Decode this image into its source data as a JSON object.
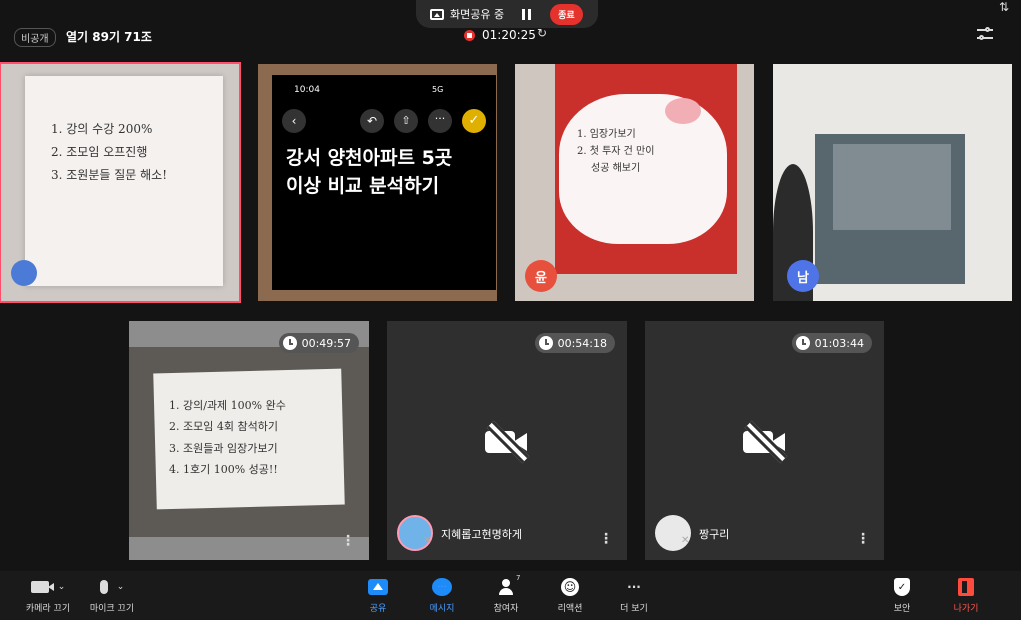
{
  "share_bar": {
    "label": "화면공유 중",
    "end_label": "종료"
  },
  "header": {
    "visibility": "비공개",
    "title": "열기 89기 71조",
    "elapsed": "01:20:25"
  },
  "tiles": {
    "t1": {
      "lines": [
        "1. 강의 수강 200%",
        "2. 조모임 오프진행",
        "3. 조원분들 질문 해소!"
      ]
    },
    "t2": {
      "status_time": "10:04",
      "status_net": "5G",
      "note_text": "강서 양천아파트 5곳 이상 비교 분석하기"
    },
    "t3": {
      "lines": [
        "1. 임장가보기",
        "2. 첫 투자 건 만이",
        "성공 해보기"
      ],
      "avatar": "윤"
    },
    "t4": {
      "avatar": "남"
    },
    "t5": {
      "time": "00:49:57",
      "lines": [
        "1. 강의/과제 100% 완수",
        "2. 조모임 4회 참석하기",
        "3. 조원들과 임장가보기",
        "4. 1호기 100% 성공!!"
      ]
    },
    "t6": {
      "time": "00:54:18",
      "name": "지혜롭고현명하게"
    },
    "t7": {
      "time": "01:03:44",
      "name": "짱구리"
    }
  },
  "toolbar": {
    "camera": "카메라 끄기",
    "mic": "마이크 끄기",
    "share": "공유",
    "message": "메시지",
    "participants": "참여자",
    "participant_count": "7",
    "reaction": "리액션",
    "more": "더 보기",
    "security": "보안",
    "leave": "나가기"
  },
  "colors": {
    "accent_blue": "#1d8cf8",
    "end_red": "#e5322d",
    "leave_red": "#ff5a4e",
    "active_border": "#ff4f6d"
  }
}
